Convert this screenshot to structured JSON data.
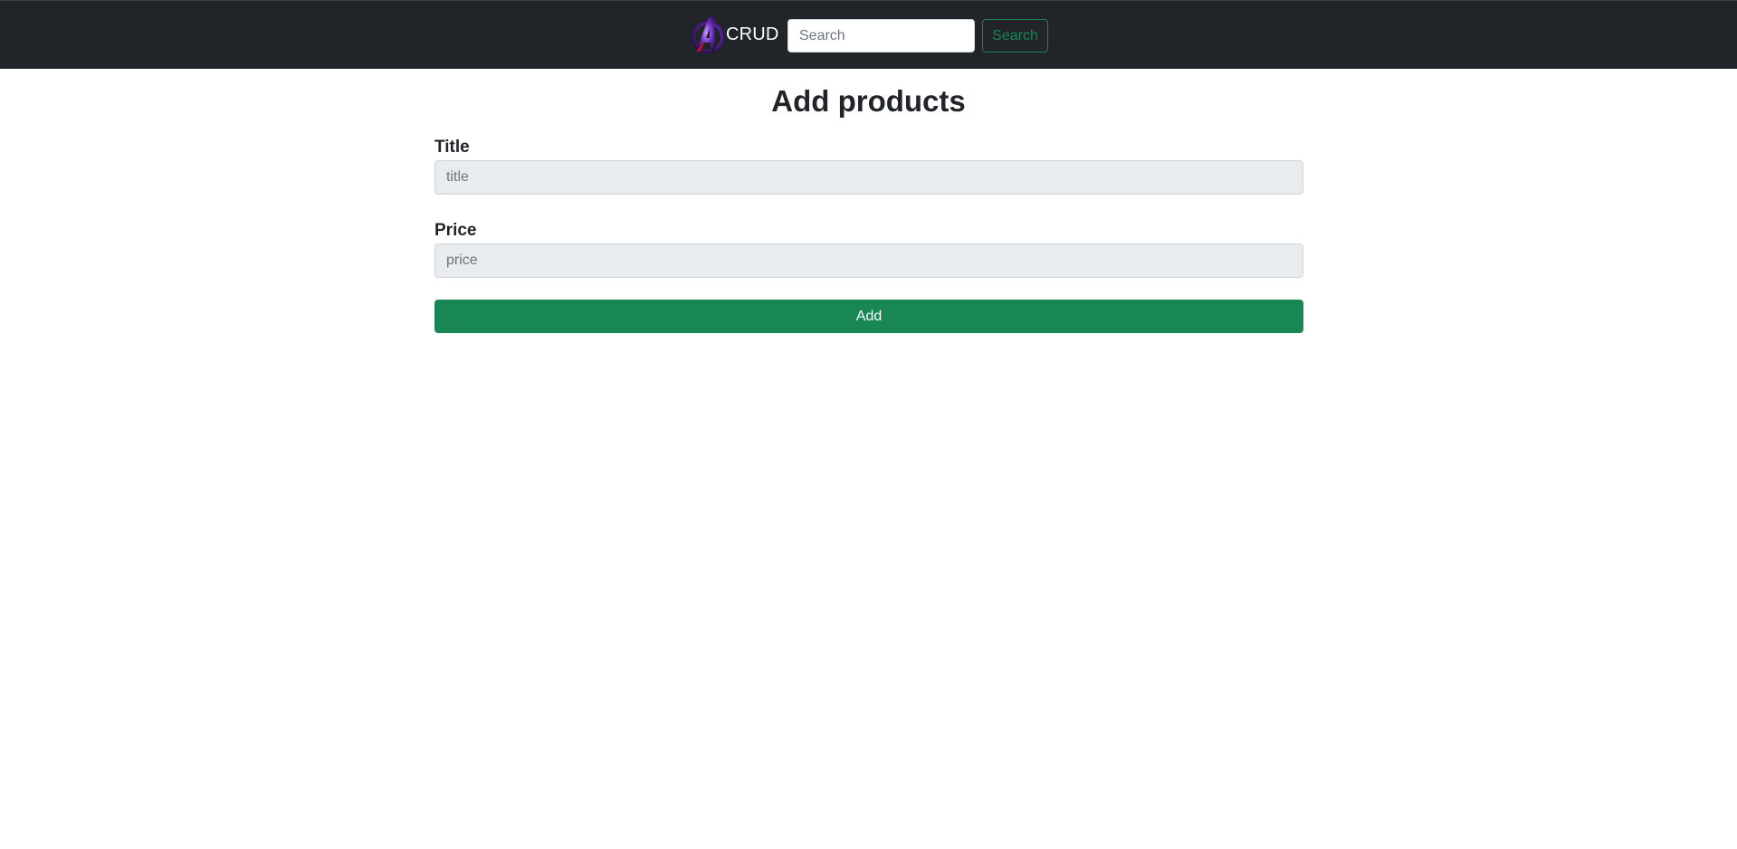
{
  "navbar": {
    "brand_text": "CRUD",
    "logo_icon": "avengers-logo-icon",
    "search_placeholder": "Search",
    "search_value": "",
    "search_button_label": "Search"
  },
  "main": {
    "title": "Add products",
    "fields": [
      {
        "label": "Title",
        "placeholder": "title",
        "value": ""
      },
      {
        "label": "Price",
        "placeholder": "price",
        "value": ""
      }
    ],
    "add_button_label": "Add"
  },
  "colors": {
    "navbar_bg": "#212529",
    "success": "#198754",
    "input_bg": "#e9ecef"
  }
}
